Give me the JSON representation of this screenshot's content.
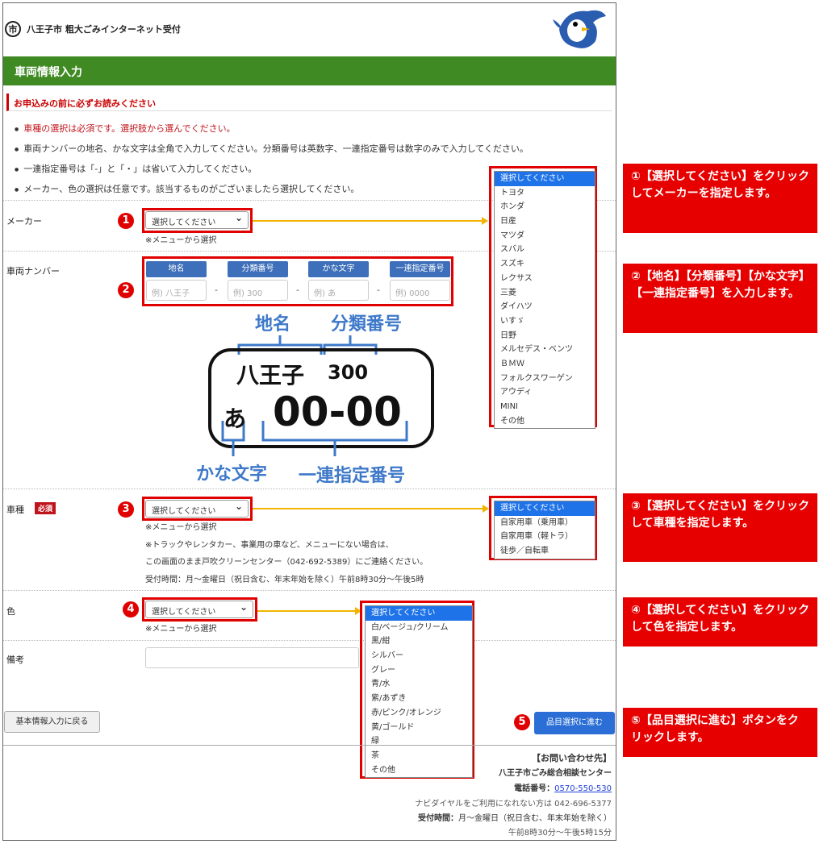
{
  "header": {
    "site_title": "八王子市 粗大ごみインターネット受付",
    "logo_glyph": "市"
  },
  "page_title": "車両情報入力",
  "notice": {
    "heading": "お申込みの前に必ずお読みください",
    "items": [
      "車種の選択は必須です。選択肢から選んでください。",
      "車両ナンバーの地名、かな文字は全角で入力してください。分類番号は英数字、一連指定番号は数字のみで入力してください。",
      "一連指定番号は「-」と「・」は省いて入力してください。",
      "メーカー、色の選択は任意です。該当するものがございましたら選択してください。"
    ]
  },
  "maker": {
    "label": "メーカー",
    "select_value": "選択してください",
    "note": "※メニューから選択",
    "options": [
      "選択してください",
      "トヨタ",
      "ホンダ",
      "日産",
      "マツダ",
      "スバル",
      "スズキ",
      "レクサス",
      "三菱",
      "ダイハツ",
      "いすゞ",
      "日野",
      "メルセデス・ベンツ",
      "ＢＭＷ",
      "フォルクスワーゲン",
      "アウディ",
      "MINI",
      "その他"
    ]
  },
  "plate": {
    "label": "車両ナンバー",
    "headers": [
      "地名",
      "分類番号",
      "かな文字",
      "一連指定番号"
    ],
    "placeholders": [
      "例) 八王子",
      "例) 300",
      "例) あ",
      "例) 0000"
    ],
    "separator": "-",
    "diagram": {
      "label_region": "地名",
      "label_class": "分類番号",
      "label_kana": "かな文字",
      "label_serial": "一連指定番号",
      "plate_region": "八王子",
      "plate_class": "300",
      "plate_kana": "あ",
      "plate_serial": "00-00"
    }
  },
  "vehicle_type": {
    "label": "車種",
    "required_badge": "必須",
    "select_value": "選択してください",
    "note": "※メニューから選択",
    "note2": "※トラックやレンタカー、事業用の車など、メニューにない場合は、",
    "note3": "この画面のまま戸吹クリーンセンター（042-692-5389）にご連絡ください。",
    "note4": "受付時間：月～金曜日（祝日含む、年末年始を除く）午前8時30分～午後5時",
    "options": [
      "選択してください",
      "自家用車（乗用車）",
      "自家用車（軽トラ）",
      "徒歩／自転車"
    ]
  },
  "color": {
    "label": "色",
    "select_value": "選択してください",
    "note": "※メニューから選択",
    "options": [
      "選択してください",
      "白/ベージュ/クリーム",
      "黒/紺",
      "シルバー",
      "グレー",
      "青/水",
      "紫/あずき",
      "赤/ピンク/オレンジ",
      "黄/ゴールド",
      "緑",
      "茶",
      "その他"
    ]
  },
  "remarks": {
    "label": "備考"
  },
  "buttons": {
    "back": "基本情報入力に戻る",
    "next": "品目選択に進む"
  },
  "contact": {
    "heading": "【お問い合わせ先】",
    "center": "八王子市ごみ総合相談センター",
    "phone_label": "電話番号：",
    "phone": "0570-550-530",
    "navi": "ナビダイヤルをご利用になれない方は 042-696-5377",
    "hours_label": "受付時間：",
    "hours": "月～金曜日（祝日含む、年末年始を除く）",
    "hours2": "午前8時30分～午後5時15分"
  },
  "annotations": {
    "step_numbers": [
      "1",
      "2",
      "3",
      "4",
      "5"
    ],
    "panel1": "①【選択してください】をクリックしてメーカーを指定します。",
    "panel2": "②【地名】【分類番号】【かな文字】【一連指定番号】を入力します。",
    "panel3": "③【選択してください】をクリックして車種を指定します。",
    "panel4": "④【選択してください】をクリックして色を指定します。",
    "panel5": "⑤【品目選択に進む】ボタンをクリックします。"
  },
  "colors": {
    "header_green": "#3f8a22",
    "annotation_red": "#e60000",
    "arrow_yellow": "#f2b400",
    "plate_header_blue": "#3e6fba",
    "button_blue": "#2b6fd6"
  }
}
